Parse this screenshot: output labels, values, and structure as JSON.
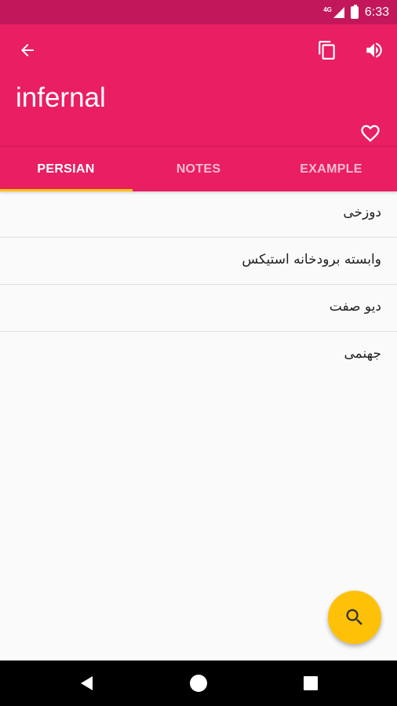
{
  "status_bar": {
    "network": "4G",
    "battery_level": 1.0,
    "time": "6:33"
  },
  "app_bar": {
    "word": "infernal",
    "icons": [
      "arrow-back-icon",
      "copy-icon",
      "volume-up-icon",
      "heart-outline-icon"
    ]
  },
  "tabs": [
    {
      "label": "PERSIAN",
      "active": true
    },
    {
      "label": "NOTES",
      "active": false
    },
    {
      "label": "EXAMPLE",
      "active": false
    }
  ],
  "translations": [
    "دوزخی",
    "وابسته برودخانه استیکس",
    "دیو صفت",
    "جهنمی"
  ],
  "fab": {
    "icon": "search-icon"
  },
  "nav_bar": {
    "icons": [
      "back-triangle-icon",
      "home-circle-icon",
      "recents-square-icon"
    ]
  },
  "colors": {
    "primary": "#e91e63",
    "primary_dark": "#c2185b",
    "accent": "#ffc107",
    "background": "#fafafa"
  }
}
